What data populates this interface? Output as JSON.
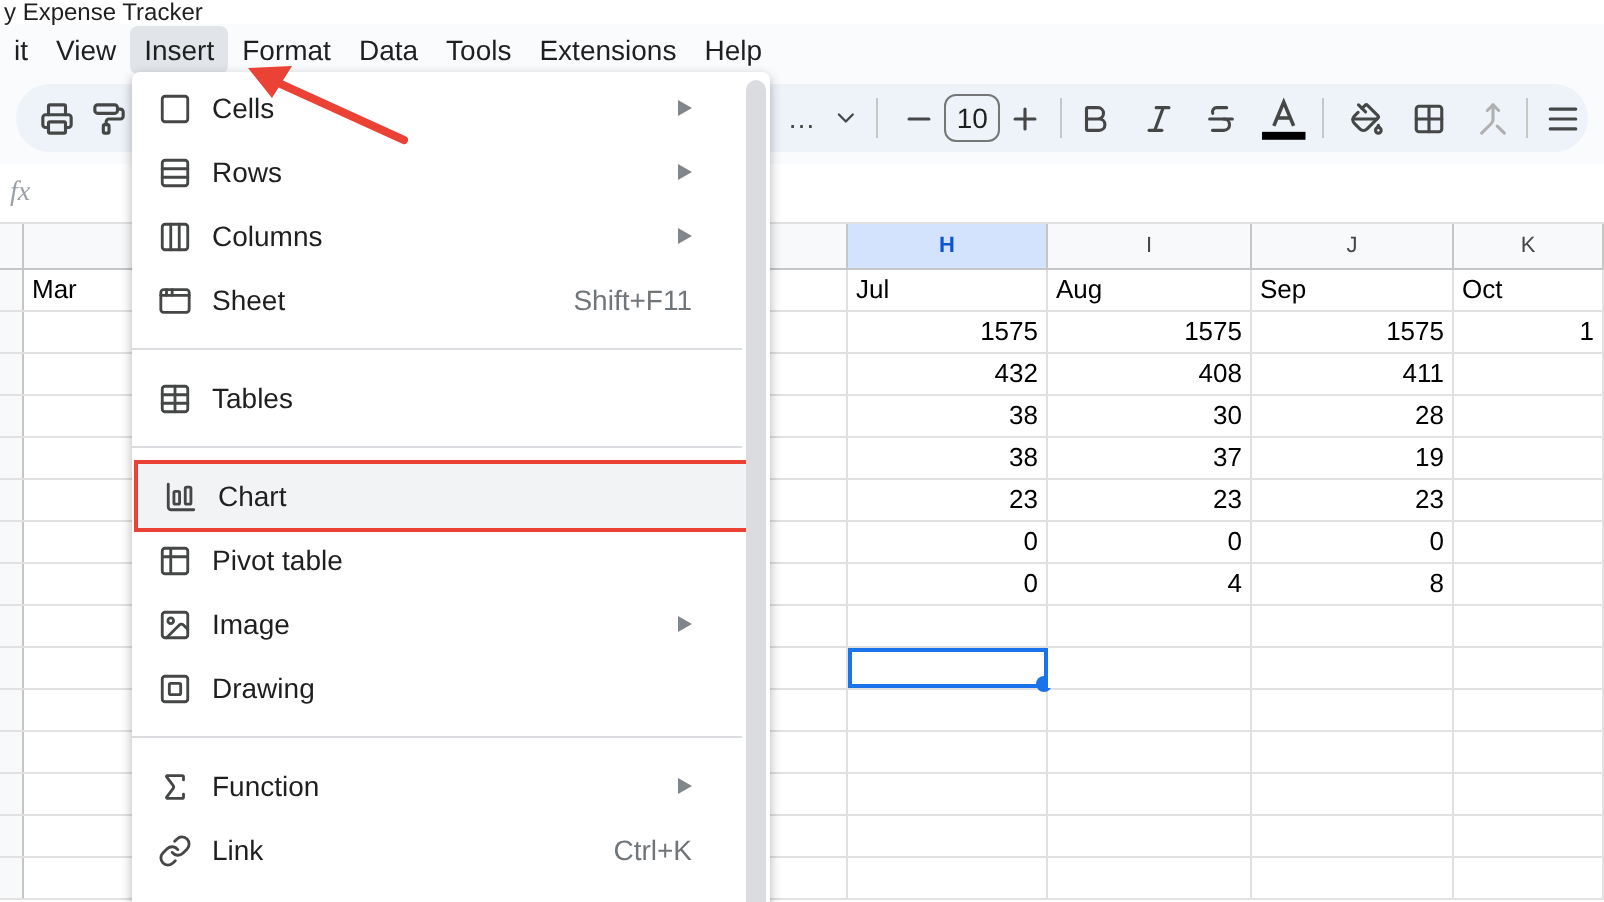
{
  "document_title": "y Expense Tracker",
  "menu_bar": [
    {
      "label": "it",
      "selected": false
    },
    {
      "label": "View",
      "selected": false
    },
    {
      "label": "Insert",
      "selected": true
    },
    {
      "label": "Format",
      "selected": false
    },
    {
      "label": "Data",
      "selected": false
    },
    {
      "label": "Tools",
      "selected": false
    },
    {
      "label": "Extensions",
      "selected": false
    },
    {
      "label": "Help",
      "selected": false
    }
  ],
  "toolbar": {
    "font_name": "…",
    "font_size": "10"
  },
  "formula_bar": {
    "label": "fx"
  },
  "columns": [
    {
      "letter": "H",
      "selected": true
    },
    {
      "letter": "I",
      "selected": false
    },
    {
      "letter": "J",
      "selected": false
    },
    {
      "letter": "K",
      "selected": false
    }
  ],
  "rows": [
    {
      "kind": "text",
      "cells": [
        {
          "text": "Mar",
          "selected": false
        },
        {
          "text": "Jul",
          "selected": false
        },
        {
          "text": "Aug",
          "selected": false
        },
        {
          "text": "Sep",
          "selected": false
        },
        {
          "text": "Oct",
          "selected": false
        }
      ]
    },
    {
      "kind": "number",
      "cells": [
        {
          "selected": false
        },
        {
          "text": "1575",
          "selected": false
        },
        {
          "text": "1575",
          "selected": false
        },
        {
          "text": "1575",
          "selected": false
        },
        {
          "text": "1",
          "selected": false
        }
      ]
    },
    {
      "kind": "number",
      "cells": [
        {
          "selected": false
        },
        {
          "text": "432",
          "selected": false
        },
        {
          "text": "408",
          "selected": false
        },
        {
          "text": "411",
          "selected": false
        },
        {
          "selected": false
        }
      ]
    },
    {
      "kind": "number",
      "cells": [
        {
          "selected": false
        },
        {
          "text": "38",
          "selected": false
        },
        {
          "text": "30",
          "selected": false
        },
        {
          "text": "28",
          "selected": false
        },
        {
          "selected": false
        }
      ]
    },
    {
      "kind": "number",
      "cells": [
        {
          "selected": false
        },
        {
          "text": "38",
          "selected": false
        },
        {
          "text": "37",
          "selected": false
        },
        {
          "text": "19",
          "selected": false
        },
        {
          "selected": false
        }
      ]
    },
    {
      "kind": "number",
      "cells": [
        {
          "selected": false
        },
        {
          "text": "23",
          "selected": false
        },
        {
          "text": "23",
          "selected": false
        },
        {
          "text": "23",
          "selected": false
        },
        {
          "selected": false
        }
      ]
    },
    {
      "kind": "number",
      "cells": [
        {
          "selected": false
        },
        {
          "text": "0",
          "selected": false
        },
        {
          "text": "0",
          "selected": false
        },
        {
          "text": "0",
          "selected": false
        },
        {
          "selected": false
        }
      ]
    },
    {
      "kind": "number",
      "cells": [
        {
          "selected": false
        },
        {
          "text": "0",
          "selected": false
        },
        {
          "text": "4",
          "selected": false
        },
        {
          "text": "8",
          "selected": false
        },
        {
          "selected": false
        }
      ]
    },
    {
      "kind": "number",
      "cells": [
        {
          "selected": false
        },
        {
          "selected": false
        },
        {
          "selected": false
        },
        {
          "selected": false
        },
        {
          "selected": false
        }
      ]
    },
    {
      "kind": "number",
      "cells": [
        {
          "selected": false
        },
        {
          "selected": true
        },
        {
          "selected": false
        },
        {
          "selected": false
        },
        {
          "selected": false
        }
      ]
    }
  ],
  "insert_menu": [
    {
      "kind": "item",
      "label": "Cells",
      "submenu": true,
      "selected": false
    },
    {
      "kind": "item",
      "label": "Rows",
      "submenu": true,
      "selected": false
    },
    {
      "kind": "item",
      "label": "Columns",
      "submenu": true,
      "selected": false
    },
    {
      "kind": "item",
      "label": "Sheet",
      "shortcut": "Shift+F11",
      "submenu": false,
      "selected": false
    },
    {
      "kind": "divider"
    },
    {
      "kind": "item",
      "label": "Tables",
      "submenu": false,
      "selected": false
    },
    {
      "kind": "divider"
    },
    {
      "kind": "item",
      "label": "Chart",
      "submenu": false,
      "selected": true
    },
    {
      "kind": "item",
      "label": "Pivot table",
      "submenu": false,
      "selected": false
    },
    {
      "kind": "item",
      "label": "Image",
      "submenu": true,
      "selected": false
    },
    {
      "kind": "item",
      "label": "Drawing",
      "submenu": false,
      "selected": false
    },
    {
      "kind": "divider"
    },
    {
      "kind": "item",
      "label": "Function",
      "submenu": true,
      "selected": false
    },
    {
      "kind": "item",
      "label": "Link",
      "shortcut": "Ctrl+K",
      "submenu": false,
      "selected": false
    }
  ]
}
